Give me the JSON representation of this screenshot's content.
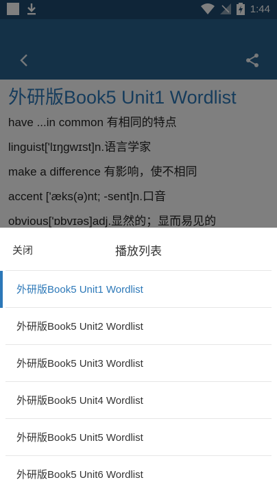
{
  "status_bar": {
    "time": "1:44",
    "icons": [
      "notification-square-icon",
      "download-icon",
      "wifi-icon",
      "no-signal-icon",
      "battery-icon"
    ]
  },
  "app_bar": {
    "back_icon": "chevron-left-icon",
    "share_icon": "share-icon",
    "color": "#28638f"
  },
  "content": {
    "title": "外研版Book5 Unit1 Wordlist",
    "lines": [
      "have ...in common 有相同的特点",
      "linguist['lɪŋgwɪst]n.语言学家",
      "make a difference 有影响，使不相同",
      "accent ['æks(ə)nt; -sent]n.口音",
      "obvious['ɒbvɪəs]adj.显然的；显而易见的"
    ]
  },
  "sheet": {
    "close_label": "关闭",
    "title": "播放列表",
    "items": [
      "外研版Book5 Unit1 Wordlist",
      "外研版Book5 Unit2 Wordlist",
      "外研版Book5 Unit3 Wordlist",
      "外研版Book5 Unit4 Wordlist",
      "外研版Book5 Unit5 Wordlist",
      "外研版Book5 Unit6 Wordlist"
    ],
    "active_index": 0,
    "accent_color": "#2c78b8"
  }
}
